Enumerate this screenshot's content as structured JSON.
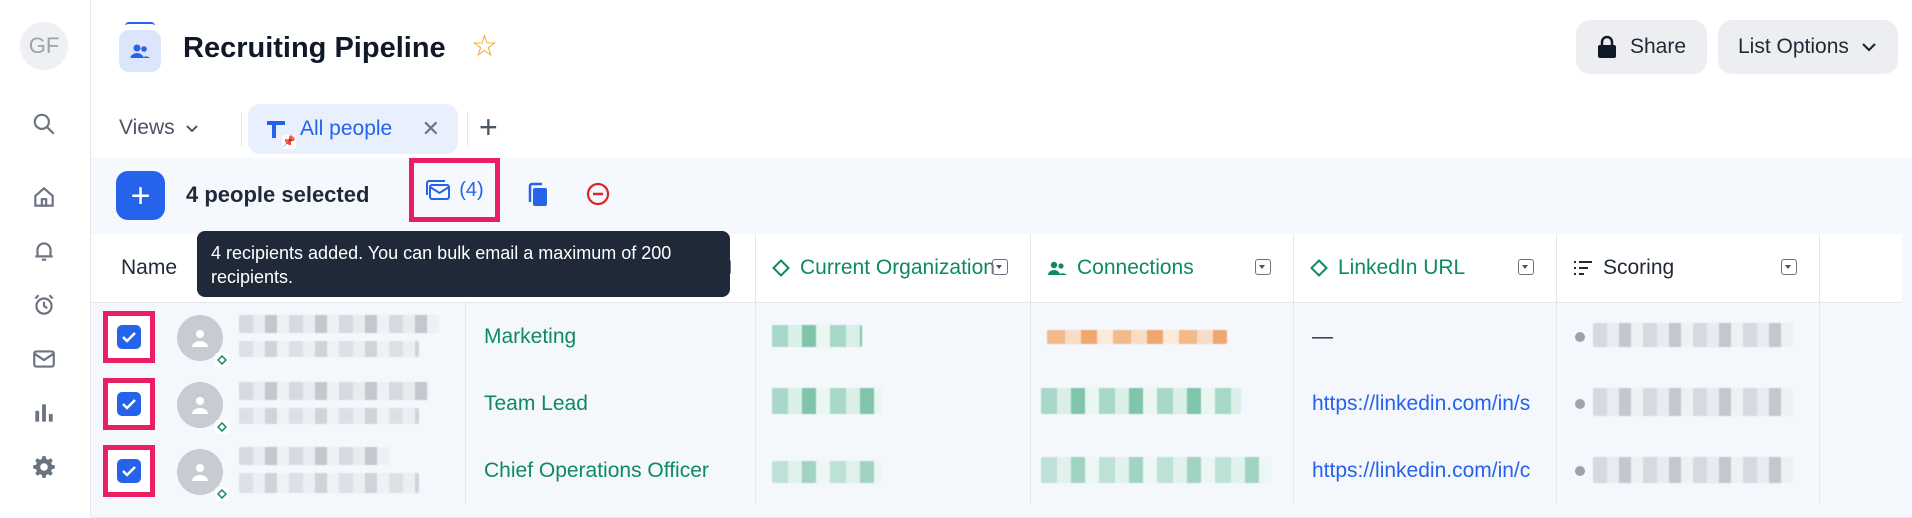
{
  "user": {
    "initials": "GF"
  },
  "nav_icons": [
    "search-icon",
    "home-icon",
    "bell-icon",
    "alarm-clock-icon",
    "mail-icon",
    "bar-chart-icon",
    "gear-icon"
  ],
  "header": {
    "title": "Recruiting Pipeline",
    "share_label": "Share",
    "list_options_label": "List Options"
  },
  "views": {
    "label": "Views",
    "active_tab": "All people",
    "add_label": "+"
  },
  "toolbar": {
    "selected_text": "4 people selected",
    "email_count": "(4)"
  },
  "tooltip": {
    "text": "4 recipients added. You can bulk email a maximum of 200 recipients."
  },
  "table": {
    "columns": [
      {
        "key": "name",
        "label": "Name"
      },
      {
        "key": "org",
        "label": "Current Organization"
      },
      {
        "key": "connections",
        "label": "Connections"
      },
      {
        "key": "linkedin",
        "label": "LinkedIn URL"
      },
      {
        "key": "scoring",
        "label": "Scoring"
      }
    ],
    "rows": [
      {
        "role": "Marketing",
        "linkedin": "—"
      },
      {
        "role": "Team Lead",
        "linkedin": "https://linkedin.com/in/s"
      },
      {
        "role": "Chief Operations Officer",
        "linkedin": "https://linkedin.com/in/c"
      }
    ]
  },
  "colors": {
    "accent": "#2563eb",
    "highlight": "#e91e63",
    "green": "#0f8a5f",
    "star": "#f59e0b"
  }
}
